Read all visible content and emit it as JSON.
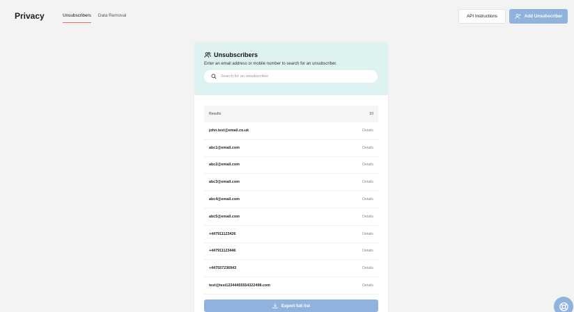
{
  "header": {
    "title": "Privacy",
    "tabs": [
      {
        "label": "Unsubscribers",
        "active": true
      },
      {
        "label": "Data Removal",
        "active": false
      }
    ],
    "api_label": "API Instructions",
    "add_label": "Add Unsubscriber"
  },
  "card": {
    "title": "Unsubscribers",
    "description": "Enter an email address or mobile number to search for an unsubscriber.",
    "search_placeholder": "Search for an unsubscriber",
    "results_label": "Results",
    "results_count": "10",
    "rows": [
      {
        "value": "john.test@email.co.uk",
        "action": "Details"
      },
      {
        "value": "abc1@email.com",
        "action": "Details"
      },
      {
        "value": "abc2@email.com",
        "action": "Details"
      },
      {
        "value": "abc3@email.com",
        "action": "Details"
      },
      {
        "value": "abc4@email.com",
        "action": "Details"
      },
      {
        "value": "abc5@email.com",
        "action": "Details"
      },
      {
        "value": "+447911123426",
        "action": "Details"
      },
      {
        "value": "+447911123446",
        "action": "Details"
      },
      {
        "value": "+447557236943",
        "action": "Details"
      },
      {
        "value": "test@test123444555543224​98.com",
        "action": "Details"
      }
    ],
    "export_label": "Export full list"
  },
  "colors": {
    "accent": "#8fb3dc",
    "header_bg": "#dff2f2",
    "active_tab_underline": "#e36a6a"
  }
}
